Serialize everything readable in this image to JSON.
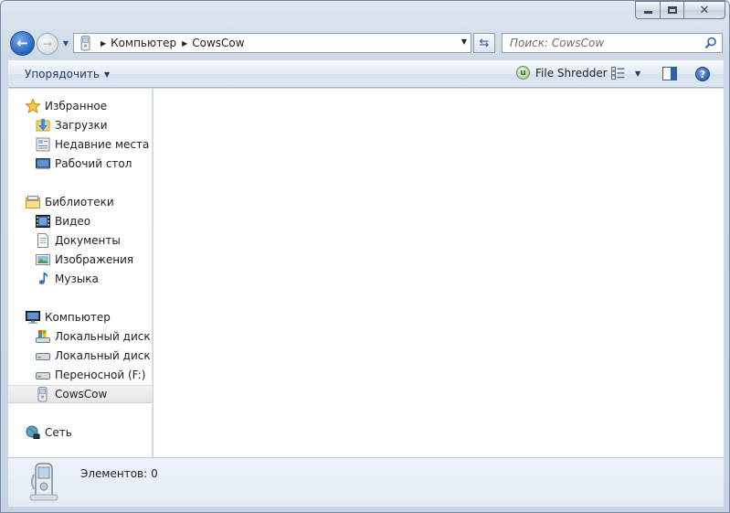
{
  "window": {
    "caption": {
      "minimize_icon": "minimize-icon",
      "maximize_icon": "maximize-icon",
      "close_icon": "close-icon"
    }
  },
  "navigation": {
    "back_icon": "back-arrow-icon",
    "forward_icon": "forward-arrow-icon",
    "history_dropdown_icon": "chevron-down-icon"
  },
  "address_bar": {
    "icon": "portable-device-icon",
    "breadcrumbs": [
      "Компьютер",
      "CowsCow"
    ]
  },
  "search": {
    "placeholder": "Поиск: CowsCow",
    "icon": "search-icon"
  },
  "toolbar": {
    "organize_label": "Упорядочить",
    "file_shredder_label": "File Shredder",
    "views_icon": "views-icon",
    "preview_pane_icon": "preview-pane-icon",
    "help_icon": "help-icon"
  },
  "sidebar": {
    "favorites": {
      "label": "Избранное",
      "icon": "star-icon",
      "items": [
        {
          "label": "Загрузки",
          "icon": "downloads-folder-icon"
        },
        {
          "label": "Недавние места",
          "icon": "recent-places-icon"
        },
        {
          "label": "Рабочий стол",
          "icon": "desktop-icon"
        }
      ]
    },
    "libraries": {
      "label": "Библиотеки",
      "icon": "libraries-icon",
      "items": [
        {
          "label": "Видео",
          "icon": "video-icon"
        },
        {
          "label": "Документы",
          "icon": "documents-icon"
        },
        {
          "label": "Изображения",
          "icon": "pictures-icon"
        },
        {
          "label": "Музыка",
          "icon": "music-icon"
        }
      ]
    },
    "computer": {
      "label": "Компьютер",
      "icon": "computer-icon",
      "items": [
        {
          "label": "Локальный диск (C",
          "icon": "system-drive-icon"
        },
        {
          "label": "Локальный диск (D",
          "icon": "hard-drive-icon"
        },
        {
          "label": "Переносной (F:)",
          "icon": "removable-drive-icon"
        },
        {
          "label": "CowsCow",
          "icon": "portable-device-icon",
          "selected": true
        }
      ]
    },
    "network": {
      "label": "Сеть",
      "icon": "network-icon"
    }
  },
  "details_pane": {
    "icon": "portable-device-icon",
    "items_label": "Элементов:",
    "items_count": "0"
  }
}
